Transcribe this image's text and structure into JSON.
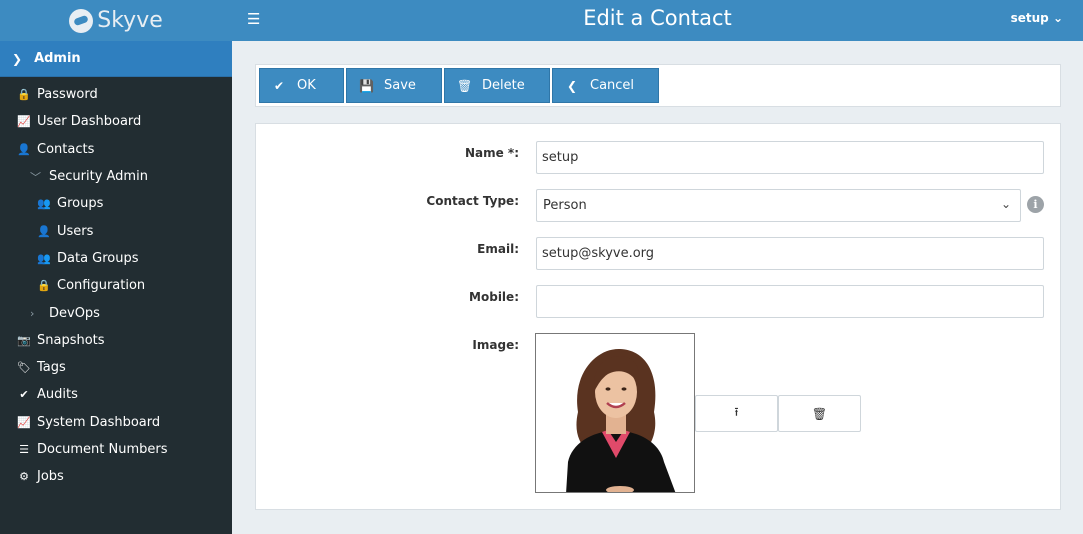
{
  "brand": {
    "name": "Skyve"
  },
  "sidebar": {
    "module": "Admin",
    "items": [
      {
        "label": "Password",
        "icon": "lock-icon",
        "glyph": "🔒",
        "level": 0
      },
      {
        "label": "User Dashboard",
        "icon": "area-chart-icon",
        "glyph": "📈",
        "level": 0
      },
      {
        "label": "Contacts",
        "icon": "user-icon",
        "glyph": "👤",
        "level": 0
      },
      {
        "label": "Security Admin",
        "icon": "chevron-down-icon",
        "glyph": "﹀",
        "level": 1
      },
      {
        "label": "Groups",
        "icon": "users-icon",
        "glyph": "👥",
        "level": 2
      },
      {
        "label": "Users",
        "icon": "user-icon",
        "glyph": "👤",
        "level": 2
      },
      {
        "label": "Data Groups",
        "icon": "users-icon",
        "glyph": "👥",
        "level": 2
      },
      {
        "label": "Configuration",
        "icon": "lock-icon",
        "glyph": "🔒",
        "level": 2
      },
      {
        "label": "DevOps",
        "icon": "chevron-right-icon",
        "glyph": "›",
        "level": 1
      },
      {
        "label": "Snapshots",
        "icon": "camera-icon",
        "glyph": "📷",
        "level": 0
      },
      {
        "label": "Tags",
        "icon": "tag-icon",
        "glyph": "🏷",
        "level": 0
      },
      {
        "label": "Audits",
        "icon": "check-icon",
        "glyph": "✔",
        "level": 0
      },
      {
        "label": "System Dashboard",
        "icon": "area-chart-icon",
        "glyph": "📈",
        "level": 0
      },
      {
        "label": "Document Numbers",
        "icon": "list-ol-icon",
        "glyph": "☰",
        "level": 0
      },
      {
        "label": "Jobs",
        "icon": "cogs-icon",
        "glyph": "⚙",
        "level": 0
      }
    ]
  },
  "header": {
    "title": "Edit a Contact",
    "user": "setup"
  },
  "toolbar": {
    "ok": "OK",
    "save": "Save",
    "delete": "Delete",
    "cancel": "Cancel"
  },
  "form": {
    "name_label": "Name *:",
    "name_value": "setup",
    "type_label": "Contact Type:",
    "type_value": "Person",
    "email_label": "Email:",
    "email_value": "setup@skyve.org",
    "mobile_label": "Mobile:",
    "mobile_value": "",
    "image_label": "Image:"
  },
  "colors": {
    "brand_blue": "#3d8bc1",
    "sidebar_bg": "#222d32",
    "page_bg": "#e9eef2"
  }
}
